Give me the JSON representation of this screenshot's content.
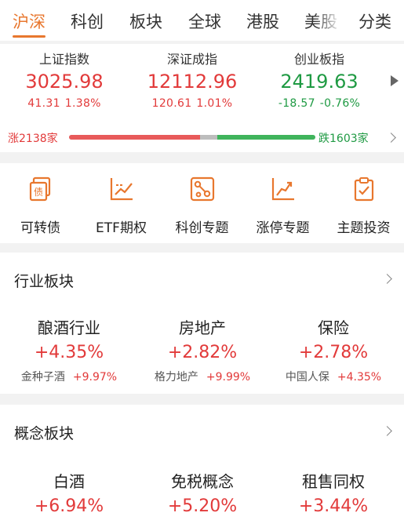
{
  "tabs": [
    {
      "label": "沪深",
      "active": true
    },
    {
      "label": "科创",
      "active": false
    },
    {
      "label": "板块",
      "active": false
    },
    {
      "label": "全球",
      "active": false
    },
    {
      "label": "港股",
      "active": false
    },
    {
      "label": "美股",
      "active": false
    },
    {
      "label": "分类",
      "active": false
    }
  ],
  "indices": [
    {
      "name": "上证指数",
      "value": "3025.98",
      "change": "41.31",
      "pct": "1.38%",
      "trend": "up"
    },
    {
      "name": "深证成指",
      "value": "12112.96",
      "change": "120.61",
      "pct": "1.01%",
      "trend": "up"
    },
    {
      "name": "创业板指",
      "value": "2419.63",
      "change": "-18.57",
      "pct": "-0.76%",
      "trend": "down"
    }
  ],
  "breadth": {
    "up_label": "涨2138家",
    "down_label": "跌1603家",
    "up_count": 2138,
    "down_count": 1603,
    "up_color": "#e85a5a",
    "down_color": "#3fb45c"
  },
  "shortcuts": [
    {
      "label": "可转债",
      "icon": "bond-icon"
    },
    {
      "label": "ETF期权",
      "icon": "options-chart-icon"
    },
    {
      "label": "科创专题",
      "icon": "network-icon"
    },
    {
      "label": "涨停专题",
      "icon": "trend-up-icon"
    },
    {
      "label": "主题投资",
      "icon": "clipboard-check-icon"
    }
  ],
  "industry": {
    "title": "行业板块",
    "items": [
      {
        "name": "酿酒行业",
        "pct": "+4.35%",
        "stock": "金种子酒",
        "stock_pct": "+9.97%"
      },
      {
        "name": "房地产",
        "pct": "+2.82%",
        "stock": "格力地产",
        "stock_pct": "+9.99%"
      },
      {
        "name": "保险",
        "pct": "+2.78%",
        "stock": "中国人保",
        "stock_pct": "+4.35%"
      }
    ]
  },
  "concept": {
    "title": "概念板块",
    "items": [
      {
        "name": "白酒",
        "pct": "+6.94%"
      },
      {
        "name": "免税概念",
        "pct": "+5.20%"
      },
      {
        "name": "租售同权",
        "pct": "+3.44%"
      }
    ]
  },
  "colors": {
    "accent": "#e8772e",
    "up": "#e23a3a",
    "down": "#1f9a43"
  }
}
